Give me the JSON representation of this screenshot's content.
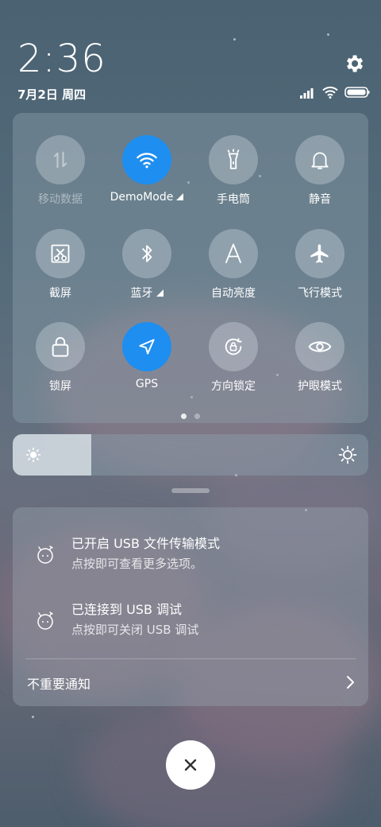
{
  "status_bar": {
    "time": "2:36",
    "date": "7月2日 周四",
    "icons": [
      "signal-icon",
      "wifi-icon",
      "battery-icon"
    ]
  },
  "quick_settings": {
    "tiles": [
      {
        "label": "移动数据",
        "icon": "mobile-data-icon",
        "state": "disabled"
      },
      {
        "label": "DemoMode",
        "icon": "wifi-icon",
        "state": "active",
        "has_submenu": true
      },
      {
        "label": "手电筒",
        "icon": "flashlight-icon",
        "state": "off"
      },
      {
        "label": "静音",
        "icon": "bell-icon",
        "state": "off"
      },
      {
        "label": "截屏",
        "icon": "screenshot-icon",
        "state": "off"
      },
      {
        "label": "蓝牙",
        "icon": "bluetooth-icon",
        "state": "off",
        "has_submenu": true
      },
      {
        "label": "自动亮度",
        "icon": "auto-brightness-icon",
        "state": "off"
      },
      {
        "label": "飞行模式",
        "icon": "airplane-icon",
        "state": "off"
      },
      {
        "label": "锁屏",
        "icon": "lock-icon",
        "state": "off"
      },
      {
        "label": "GPS",
        "icon": "location-arrow-icon",
        "state": "active"
      },
      {
        "label": "方向锁定",
        "icon": "rotation-lock-icon",
        "state": "off"
      },
      {
        "label": "护眼模式",
        "icon": "eye-icon",
        "state": "off"
      }
    ],
    "pages": 2,
    "current_page": 1
  },
  "brightness": {
    "level": 0.22
  },
  "notifications": [
    {
      "title": "已开启 USB 文件传输模式",
      "subtitle": "点按即可查看更多选项。",
      "icon": "android-debug-icon"
    },
    {
      "title": "已连接到 USB 调试",
      "subtitle": "点按即可关闭 USB 调试",
      "icon": "android-debug-icon"
    }
  ],
  "unimportant_label": "不重要通知",
  "colors": {
    "accent": "#1e8ef0"
  }
}
